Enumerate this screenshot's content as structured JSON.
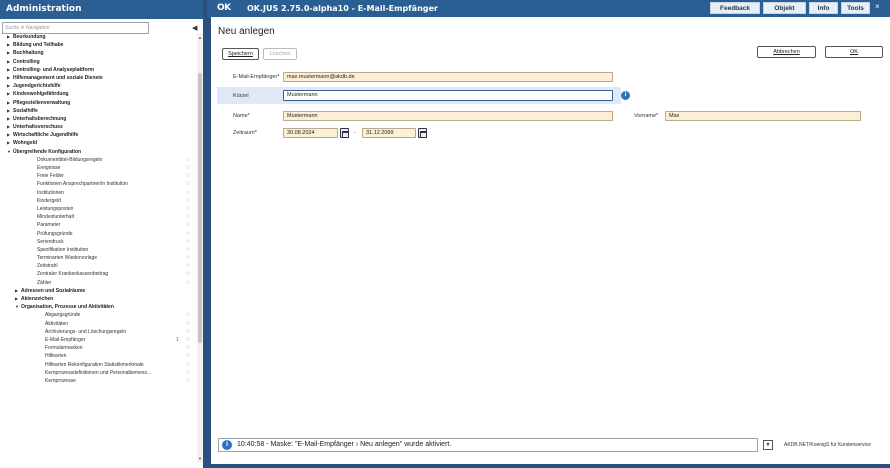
{
  "admin": {
    "title": "Administration",
    "search_placeholder": "Suche in Navigation",
    "tree": [
      {
        "label": "Beurkundung",
        "level": 1
      },
      {
        "label": "Bildung und Teilhabe",
        "level": 1
      },
      {
        "label": "Buchhaltung",
        "level": 1
      },
      {
        "label": "Controlling",
        "level": 1
      },
      {
        "label": "Controlling- und Analyseplattform",
        "level": 1
      },
      {
        "label": "Hilfemanagement und soziale Dienste",
        "level": 1
      },
      {
        "label": "Jugendgerichtshilfe",
        "level": 1
      },
      {
        "label": "Kindeswohlgefährdung",
        "level": 1
      },
      {
        "label": "Pflegestellenverwaltung",
        "level": 1
      },
      {
        "label": "Sozialhilfe",
        "level": 1
      },
      {
        "label": "Unterhaltsberechnung",
        "level": 1
      },
      {
        "label": "Unterhaltsvorschuss",
        "level": 1
      },
      {
        "label": "Wirtschaftliche Jugendhilfe",
        "level": 1
      },
      {
        "label": "Wohngeld",
        "level": 1
      },
      {
        "label": "Übergreifende Konfiguration",
        "level": 1,
        "expanded": true
      },
      {
        "label": "Dokumenttitel-Bildungsregeln",
        "level": "leaf"
      },
      {
        "label": "Ereignisse",
        "level": "leaf"
      },
      {
        "label": "Freie Felder",
        "level": "leaf"
      },
      {
        "label": "Funktionen Ansprechpartner/in Institution",
        "level": "leaf"
      },
      {
        "label": "Institutionen",
        "level": "leaf"
      },
      {
        "label": "Kindergeld",
        "level": "leaf"
      },
      {
        "label": "Leistungsposten",
        "level": "leaf"
      },
      {
        "label": "Mindestunterhalt",
        "level": "leaf"
      },
      {
        "label": "Parameter",
        "level": "leaf"
      },
      {
        "label": "Prüfungsgründe",
        "level": "leaf"
      },
      {
        "label": "Seriendruck",
        "level": "leaf"
      },
      {
        "label": "Spezifikation Institution",
        "level": "leaf"
      },
      {
        "label": "Terminarten Wiedervorlage",
        "level": "leaf"
      },
      {
        "label": "Zeitstrahl",
        "level": "leaf"
      },
      {
        "label": "Zentraler Krankenkassenbeitrag",
        "level": "leaf"
      },
      {
        "label": "Zähler",
        "level": "leaf"
      },
      {
        "label": "Adressen und Sozialräume",
        "level": 2
      },
      {
        "label": "Aktenzeichen",
        "level": 2
      },
      {
        "label": "Organisation, Prozesse und Aktivitäten",
        "level": 2,
        "expanded": true
      },
      {
        "label": "Abgangsgründe",
        "level": "leaf2"
      },
      {
        "label": "Aktivitäten",
        "level": "leaf2"
      },
      {
        "label": "Archivierungs- und Löschungsregeln",
        "level": "leaf2"
      },
      {
        "label": "E-Mail-Empfänger",
        "level": "leaf2",
        "count": "1"
      },
      {
        "label": "Formularmasken",
        "level": "leaf2"
      },
      {
        "label": "Hilfearten",
        "level": "leaf2"
      },
      {
        "label": "Hilfearten Rekonfiguration Statistikmerkmale",
        "level": "leaf2"
      },
      {
        "label": "Kernprozessdefinitionen und Personalbemess...",
        "level": "leaf2"
      },
      {
        "label": "Kernprozesse",
        "level": "leaf2"
      }
    ]
  },
  "window": {
    "logo": "OK",
    "title": "OK.JUS 2.75.0-alpha10 - E-Mail-Empfänger",
    "buttons": {
      "feedback": "Feedback",
      "objekt": "Objekt",
      "info": "Info",
      "tools": "Tools"
    },
    "close": "×"
  },
  "form": {
    "page_title": "Neu anlegen",
    "speichern": "Speichern",
    "loeschen": "Löschen",
    "abbrechen": "Abbrechen",
    "ok": "OK",
    "email_label": "E-Mail-Empfänger*",
    "email_value": "max.mustermann@akdb.de",
    "kuerzel_label": "Kürzel",
    "kuerzel_value": "Mustermann",
    "name_label": "Name*",
    "name_value": "Mustermann",
    "vorname_label": "Vorname*",
    "vorname_value": "Max",
    "zeitraum_label": "Zeitraum*",
    "zeitraum_from": "30.08.2024",
    "zeitraum_sep": "-",
    "zeitraum_to": "31.12.2099"
  },
  "status": {
    "message": "10:40:58 - Maske: \"E-Mail-Empfänger › Neu anlegen\" wurde aktiviert.",
    "right_text": "AKDB.NET/KoenigS für Kundenservice"
  },
  "colors": {
    "titlebar": "#2b5f94",
    "background": "#2b4f7e",
    "required_field": "#fdeed6",
    "info_blue": "#2f6fc5"
  }
}
